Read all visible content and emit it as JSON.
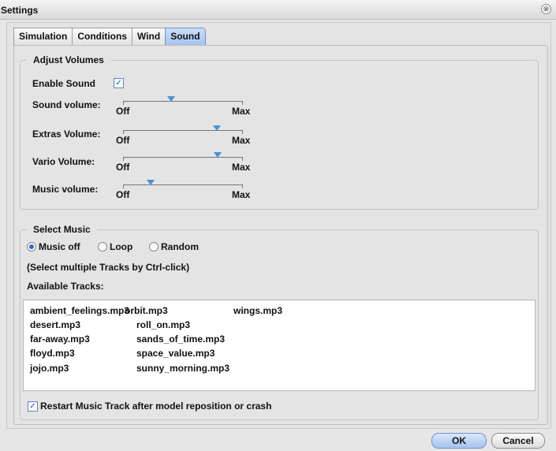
{
  "window": {
    "title": "Settings",
    "close_glyph": "⊗"
  },
  "tabs": [
    {
      "label": "Simulation",
      "active": false
    },
    {
      "label": "Conditions",
      "active": false
    },
    {
      "label": "Wind",
      "active": false
    },
    {
      "label": "Sound",
      "active": true
    }
  ],
  "adjust_volumes": {
    "legend": "Adjust Volumes",
    "enable_sound": {
      "label": "Enable Sound",
      "checked": true,
      "check_glyph": "✓"
    },
    "min_label": "Off",
    "max_label": "Max",
    "sliders": [
      {
        "label": "Sound volume:",
        "value": 0.4
      },
      {
        "label": "Extras Volume:",
        "value": 0.78
      },
      {
        "label": "Vario Volume:",
        "value": 0.79
      },
      {
        "label": "Music volume:",
        "value": 0.23
      }
    ]
  },
  "select_music": {
    "legend": "Select Music",
    "modes": [
      {
        "label": "Music off",
        "selected": true
      },
      {
        "label": "Loop",
        "selected": false
      },
      {
        "label": "Random",
        "selected": false
      }
    ],
    "hint": "(Select multiple Tracks by Ctrl-click)",
    "available_label": "Available Tracks:",
    "tracks": [
      [
        "ambient_feelings.mp3",
        "orbit.mp3",
        "wings.mp3"
      ],
      [
        "desert.mp3",
        "roll_on.mp3",
        ""
      ],
      [
        "far-away.mp3",
        "sands_of_time.mp3",
        ""
      ],
      [
        "floyd.mp3",
        "space_value.mp3",
        ""
      ],
      [
        "jojo.mp3",
        "sunny_morning.mp3",
        ""
      ]
    ],
    "restart": {
      "label": "Restart Music Track after model reposition or crash",
      "checked": true,
      "check_glyph": "✓"
    }
  },
  "buttons": {
    "ok": "OK",
    "cancel": "Cancel"
  },
  "colors": {
    "accent": "#4b8fd6",
    "tab_active": "#a6c4ef"
  },
  "icons": {
    "close": "close-icon",
    "slider_thumb": "slider-thumb-icon"
  }
}
